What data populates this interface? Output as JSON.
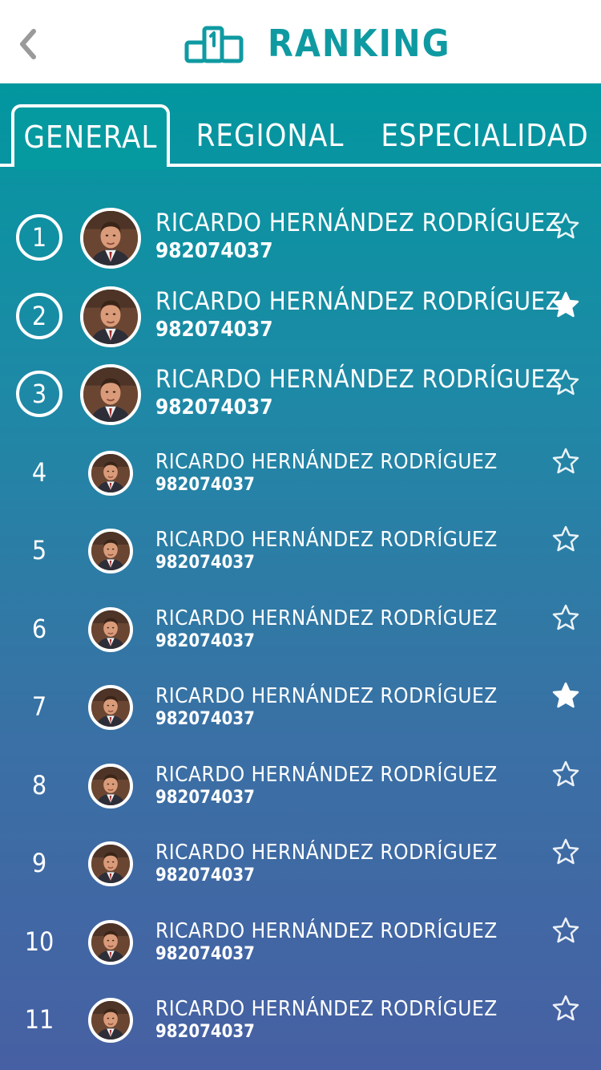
{
  "header": {
    "title": "RANKING"
  },
  "tabs": [
    {
      "label": "GENERAL",
      "active": true
    },
    {
      "label": "REGIONAL",
      "active": false
    },
    {
      "label": "ESPECIALIDAD",
      "active": false
    }
  ],
  "colors": {
    "accent": "#0f9aa2",
    "gradient_top": "#02979f",
    "gradient_bottom": "#4760a3"
  },
  "ranking": [
    {
      "rank": "1",
      "name": "RICARDO HERNÁNDEZ RODRÍGUEZ",
      "phone": "982074037",
      "starred": false
    },
    {
      "rank": "2",
      "name": "RICARDO HERNÁNDEZ RODRÍGUEZ",
      "phone": "982074037",
      "starred": true
    },
    {
      "rank": "3",
      "name": "RICARDO HERNÁNDEZ RODRÍGUEZ",
      "phone": "982074037",
      "starred": false
    },
    {
      "rank": "4",
      "name": "RICARDO HERNÁNDEZ RODRÍGUEZ",
      "phone": "982074037",
      "starred": false
    },
    {
      "rank": "5",
      "name": "RICARDO HERNÁNDEZ RODRÍGUEZ",
      "phone": "982074037",
      "starred": false
    },
    {
      "rank": "6",
      "name": "RICARDO HERNÁNDEZ RODRÍGUEZ",
      "phone": "982074037",
      "starred": false
    },
    {
      "rank": "7",
      "name": "RICARDO HERNÁNDEZ RODRÍGUEZ",
      "phone": "982074037",
      "starred": true
    },
    {
      "rank": "8",
      "name": "RICARDO HERNÁNDEZ RODRÍGUEZ",
      "phone": "982074037",
      "starred": false
    },
    {
      "rank": "9",
      "name": "RICARDO HERNÁNDEZ RODRÍGUEZ",
      "phone": "982074037",
      "starred": false
    },
    {
      "rank": "10",
      "name": "RICARDO HERNÁNDEZ RODRÍGUEZ",
      "phone": "982074037",
      "starred": false
    },
    {
      "rank": "11",
      "name": "RICARDO HERNÁNDEZ RODRÍGUEZ",
      "phone": "982074037",
      "starred": false
    }
  ]
}
